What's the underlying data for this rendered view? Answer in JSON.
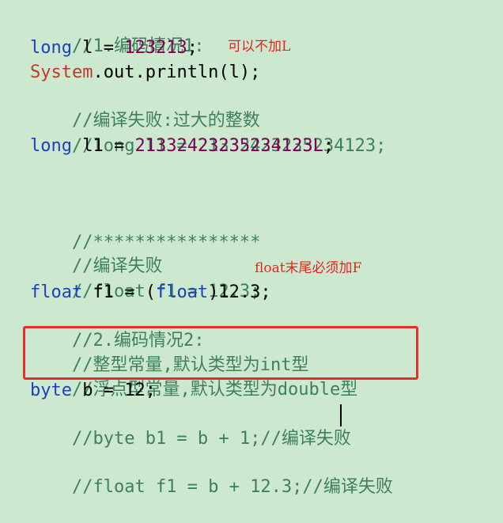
{
  "code_lines": {
    "l01_c": "//1.编码情况1:",
    "l02_kw": "long",
    "l02_pl": " l = ",
    "l02_num": "123213",
    "l02_end": ";",
    "l03_cls": "System",
    "l03_pl": ".out.println(l);",
    "l04_c": "//编译失败:过大的整数",
    "l05_c": "//long l1 = 21332423235234123;",
    "l06_kw": "long",
    "l06_pl": " l1 = ",
    "l06_num": "21332423235234123L",
    "l06_end": ";",
    "l08_c": "//****************",
    "l09_c": "//编译失败",
    "l10_c": "//float f1 = 12.3;",
    "l11_kw": "float",
    "l11_pl1": " f1 = (",
    "l11_kw2": "float",
    "l11_pl2": ")12.3;",
    "l12_c": "//2.编码情况2:",
    "l13_c": "//整型常量,默认类型为int型",
    "l14_c": "//浮点型常量,默认类型为double型",
    "l15_kw": "byte",
    "l15_pl": " b = 12;",
    "l16_c": "//byte b1 = b + 1;//编译失败",
    "l18_c": "//float f1 = b + 12.3;//编译失败"
  },
  "annotations": {
    "note1": "可以不加L",
    "note2": "float末尾必须加F"
  },
  "colors": {
    "background": "#cce8cf",
    "comment": "#3f7f5f",
    "keyword": "#1f3fbf",
    "number": "#7f0055",
    "class": "#c0392b",
    "note": "#e8231c",
    "highlight_border": "#e53030"
  }
}
